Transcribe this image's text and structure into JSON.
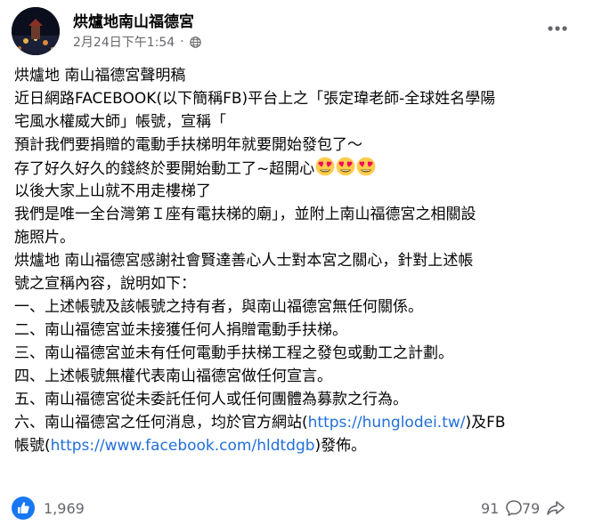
{
  "header": {
    "page_name": "烘爐地南山福德宮",
    "timestamp": "2月24日下午1:54",
    "separator": "·",
    "privacy_icon": "globe-icon",
    "more_icon": "more-options-icon"
  },
  "post": {
    "lines": [
      "烘爐地 南山福德宮聲明稿",
      "近日網路FACEBOOK(以下簡稱FB)平台上之「張定瑋老師-全球姓名學陽",
      "宅風水權威大師」帳號，宣稱「",
      "預計我們要捐贈的電動手扶梯明年就要開始發包了～",
      "存了好久好久的錢終於要開始動工了~超開心",
      "以後大家上山就不用走樓梯了",
      "我們是唯一全台灣第Ｉ座有電扶梯的廟」，並附上南山福德宮之相關設",
      "施照片。",
      "烘爐地 南山福德宮感謝社會賢達善心人士對本宮之關心，針對上述帳",
      "號之宣稱內容，說明如下：",
      "一、上述帳號及該帳號之持有者，與南山福德宮無任何關係。",
      "二、南山福德宮並未接獲任何人捐贈電動手扶梯。",
      "三、南山福德宮並未有任何電動手扶梯工程之發包或動工之計劃。",
      "四、上述帳號無權代表南山福德宮做任何宣言。",
      "五、南山福德宮從未委託任何人或任何團體為募款之行為。"
    ],
    "line16_prefix": "六、南山福德宮之任何消息，均於官方網站(",
    "website_link": "https://hunglodei.tw/",
    "line16_suffix": ")及FB",
    "line17_prefix": "帳號(",
    "facebook_link": "https://www.facebook.com/hldtdgb",
    "line17_suffix": ")發佈。",
    "emoji_icon": "heart-eyes-emoji-icon",
    "emoji_count": 3
  },
  "footer": {
    "reaction_icon": "like-icon",
    "reaction_count": "1,969",
    "comment_count": "91",
    "comment_icon": "comment-icon",
    "share_count": "79",
    "share_icon": "share-icon"
  },
  "colors": {
    "text": "#050505",
    "secondary_text": "#65676b",
    "link": "#216fdb",
    "like_blue": "#1877f2",
    "emoji_yellow": "#ffcc4d",
    "emoji_heart": "#f4005e"
  }
}
